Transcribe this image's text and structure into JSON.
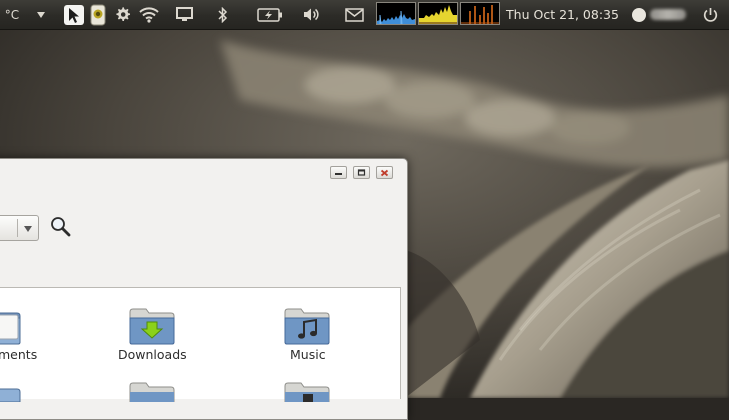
{
  "panel": {
    "temperature_unit": "°C",
    "clock": "Thu Oct 21, 08:35",
    "icons": [
      "dropdown-arrow-icon",
      "cursor-app-icon",
      "battery-indicator-app-icon",
      "gear-icon",
      "wifi-icon",
      "display-icon",
      "bluetooth-icon",
      "battery-icon",
      "volume-icon",
      "mail-icon",
      "user-status-icon",
      "power-icon"
    ],
    "graph_colors": {
      "cpu": "#3f8ed8",
      "memory": "#e6d52f",
      "network": "#e8721c"
    }
  },
  "window": {
    "controls": [
      "minimize-icon",
      "maximize-icon",
      "close-icon"
    ],
    "close_color": "#c03c2b"
  },
  "files": [
    {
      "label": "ments"
    },
    {
      "label": "Downloads"
    },
    {
      "label": "Music"
    }
  ]
}
